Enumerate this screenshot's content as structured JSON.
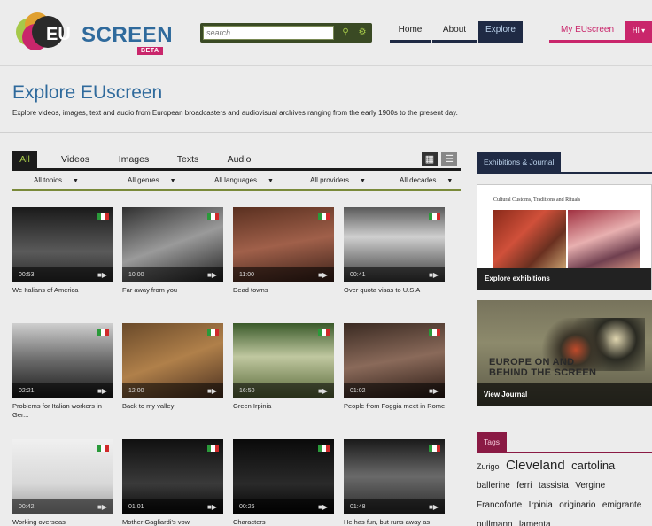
{
  "header": {
    "logo_eu": "EU",
    "logo_screen": "SCREEN",
    "logo_badge": "BETA",
    "search_placeholder": "search",
    "nav": [
      {
        "label": "Home"
      },
      {
        "label": "About"
      },
      {
        "label": "Explore",
        "active": true
      }
    ],
    "my_euscreen": "My EUscreen",
    "lang_label": "HI ▾"
  },
  "intro": {
    "title": "Explore EUscreen",
    "description": "Explore videos, images, text and audio from European broadcasters and audiovisual archives ranging from the early 1900s to the present day."
  },
  "media_tabs": [
    {
      "label": "All",
      "active": true
    },
    {
      "label": "Videos"
    },
    {
      "label": "Images"
    },
    {
      "label": "Texts"
    },
    {
      "label": "Audio"
    }
  ],
  "filters": [
    {
      "label": "All topics"
    },
    {
      "label": "All genres"
    },
    {
      "label": "All languages"
    },
    {
      "label": "All providers"
    },
    {
      "label": "All decades"
    }
  ],
  "videos": [
    {
      "title": "We Italians of America",
      "duration": "00:53"
    },
    {
      "title": "Far away from you",
      "duration": "10:00"
    },
    {
      "title": "Dead towns",
      "duration": "11:00"
    },
    {
      "title": "Over quota visas to U.S.A",
      "duration": "00:41"
    },
    {
      "title": "Problems for Italian workers in Ger...",
      "duration": "02:21"
    },
    {
      "title": "Back to my valley",
      "duration": "12:00"
    },
    {
      "title": "Green Irpinia",
      "duration": "16:50"
    },
    {
      "title": "People from Foggia meet in Rome",
      "duration": "01:02"
    },
    {
      "title": "Working overseas",
      "duration": "00:42"
    },
    {
      "title": "Mother Gagliardi's vow",
      "duration": "01:01"
    },
    {
      "title": "Characters",
      "duration": "00:26"
    },
    {
      "title": "He has fun, but runs away as",
      "duration": "01:48"
    }
  ],
  "sidebar": {
    "exhibitions_heading": "Exhibitions & Journal",
    "exhibition_subtitle": "Cultural Customs, Traditions and Rituals",
    "explore_exhibitions": "Explore exhibitions",
    "journal_cover_line1": "EUROPE ON AND",
    "journal_cover_line2": "BEHIND THE SCREEN",
    "view_journal": "View Journal",
    "tags_heading": "Tags",
    "tags": [
      {
        "label": "Zurigo",
        "size": 9
      },
      {
        "label": "Cleveland",
        "size": 15
      },
      {
        "label": "cartolina",
        "size": 13
      },
      {
        "label": "ballerine",
        "size": 10
      },
      {
        "label": "ferri",
        "size": 10
      },
      {
        "label": "tassista",
        "size": 10
      },
      {
        "label": "Vergine",
        "size": 10
      },
      {
        "label": "Francoforte",
        "size": 10
      },
      {
        "label": "Irpinia",
        "size": 10
      },
      {
        "label": "originario",
        "size": 10
      },
      {
        "label": "emigrante",
        "size": 10
      },
      {
        "label": "pullmann",
        "size": 10
      },
      {
        "label": "lamenta",
        "size": 10
      }
    ]
  },
  "colors": {
    "brand_blue": "#2f6a9c",
    "brand_pink": "#c9266b",
    "accent_green": "#a6c94a",
    "nav_dark": "#1f2a44"
  }
}
